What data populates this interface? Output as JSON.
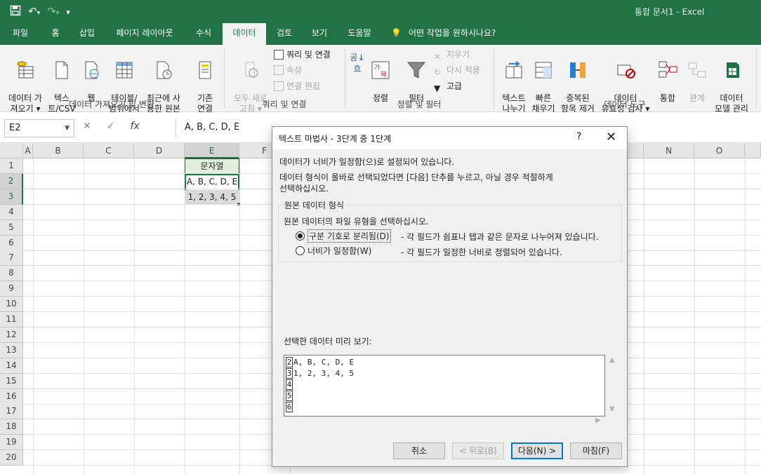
{
  "window": {
    "title": "통합 문서1  -  Excel"
  },
  "qat": {
    "save_icon": "save-icon",
    "undo_icon": "undo-icon",
    "redo_icon": "redo-icon",
    "customize_icon": "customize-icon"
  },
  "tabs": [
    {
      "label": "파일"
    },
    {
      "label": "홈"
    },
    {
      "label": "삽입"
    },
    {
      "label": "페이지 레이아웃"
    },
    {
      "label": "수식"
    },
    {
      "label": "데이터"
    },
    {
      "label": "검토"
    },
    {
      "label": "보기"
    },
    {
      "label": "도움말"
    }
  ],
  "tell_me": "어떤 작업을 원하시나요?",
  "ribbon": {
    "get_data": "데이터 가\n져오기 ▾",
    "text_csv": "텍스\n트/CSV",
    "web": "웹",
    "table_range": "테이블/\n범위에서",
    "recent_sources": "최근에 사\n용한 원본",
    "existing_conn": "기존\n연결",
    "group_get": "데이터 가져오기 및 변환",
    "refresh_all": "모두 새로\n고침 ▾",
    "queries_conn": "쿼리 및 연결",
    "properties": "속성",
    "edit_links": "연결 편집",
    "group_queries": "쿼리 및 연결",
    "sort": "정렬",
    "filter": "필터",
    "clear": "지우기",
    "reapply": "다시 적용",
    "advanced": "고급",
    "group_sort": "정렬 및 필터",
    "text_to_columns": "텍스트\n나누기",
    "flash_fill": "빠른\n채우기",
    "remove_dup": "중복된\n항목 제거",
    "data_validation": "데이터\n유효성 검사 ▾",
    "consolidate": "통합",
    "relationships": "관계",
    "data_model": "데이터\n모델 관리",
    "group_tools": "데이터 도구"
  },
  "formula_bar": {
    "name_box": "E2",
    "fx": "fx",
    "value": "A, B, C, D, E"
  },
  "grid": {
    "columns": [
      "A",
      "B",
      "C",
      "D",
      "E",
      "F",
      "N",
      "O"
    ],
    "rows": [
      "1",
      "2",
      "3",
      "4",
      "5",
      "6",
      "7",
      "8",
      "9",
      "10",
      "11",
      "12",
      "13",
      "14",
      "15",
      "16",
      "17",
      "18",
      "19",
      "20"
    ],
    "e1": "문자열",
    "e2": "A, B, C, D, E",
    "e3": "1, 2, 3, 4, 5"
  },
  "dialog": {
    "title": "텍스트 마법사 - 3단계 중 1단계",
    "help": "?",
    "line1": "데이터가 너비가 일정함(으)로 설정되어 있습니다.",
    "line2": "데이터 형식이 올바로 선택되었다면 [다음] 단추를 누르고, 아닐 경우 적절하게",
    "line3": "선택하십시오.",
    "group_title": "원본 데이터 형식",
    "group_prompt": "원본 데이터의 파일 유형을 선택하십시오.",
    "opt_delimited": "구분 기호로 분리됨(D)",
    "opt_delimited_desc": "- 각 필드가 쉼표나 탭과 같은 문자로 나누어져 있습니다.",
    "opt_fixed": "너비가 일정함(W)",
    "opt_fixed_desc": "- 각 필드가 일정한 너비로 정렬되어 있습니다.",
    "preview_label": "선택한 데이터 미리 보기:",
    "preview_rows": [
      {
        "num": "2",
        "text": "A, B, C, D, E"
      },
      {
        "num": "3",
        "text": "1, 2, 3, 4, 5"
      },
      {
        "num": "4",
        "text": ""
      },
      {
        "num": "5",
        "text": ""
      },
      {
        "num": "6",
        "text": ""
      }
    ],
    "btn_cancel": "취소",
    "btn_back": "< 뒤로(B)",
    "btn_next": "다음(N) >",
    "btn_finish": "마침(F)"
  },
  "colors": {
    "excel_green": "#217346"
  }
}
